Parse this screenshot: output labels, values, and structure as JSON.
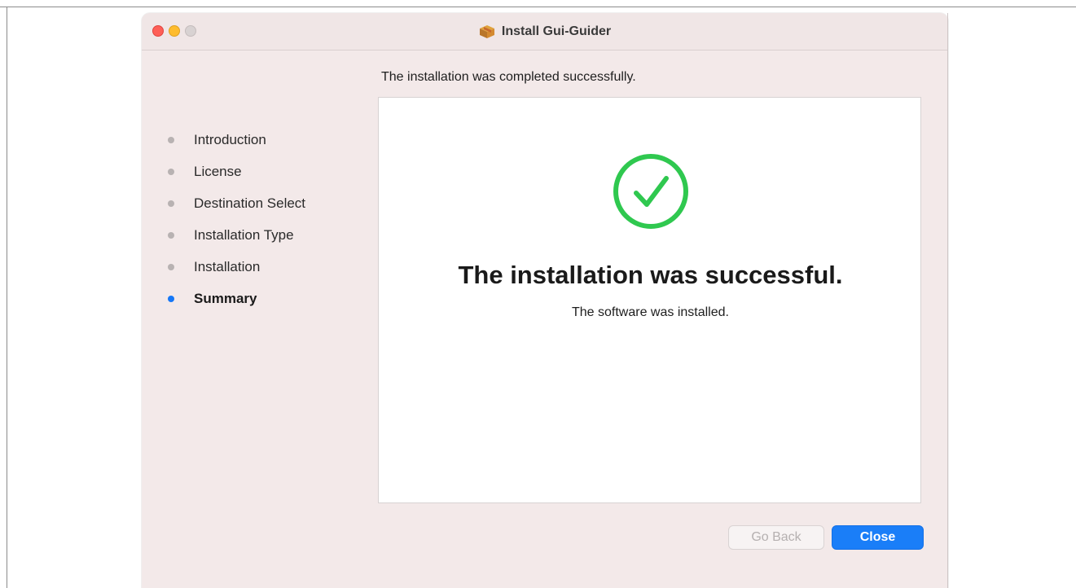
{
  "window": {
    "title": "Install Gui-Guider"
  },
  "header_message": "The installation was completed successfully.",
  "sidebar": {
    "steps": [
      {
        "label": "Introduction",
        "active": false
      },
      {
        "label": "License",
        "active": false
      },
      {
        "label": "Destination Select",
        "active": false
      },
      {
        "label": "Installation Type",
        "active": false
      },
      {
        "label": "Installation",
        "active": false
      },
      {
        "label": "Summary",
        "active": true
      }
    ]
  },
  "content": {
    "title": "The installation was successful.",
    "subtitle": "The software was installed."
  },
  "buttons": {
    "back_label": "Go Back",
    "close_label": "Close"
  },
  "colors": {
    "accent": "#1a7ef8",
    "success": "#2fc84f",
    "window_bg": "#f3e9e9"
  },
  "icons": {
    "title_icon": "package-icon",
    "success_icon": "checkmark-circle-icon"
  }
}
